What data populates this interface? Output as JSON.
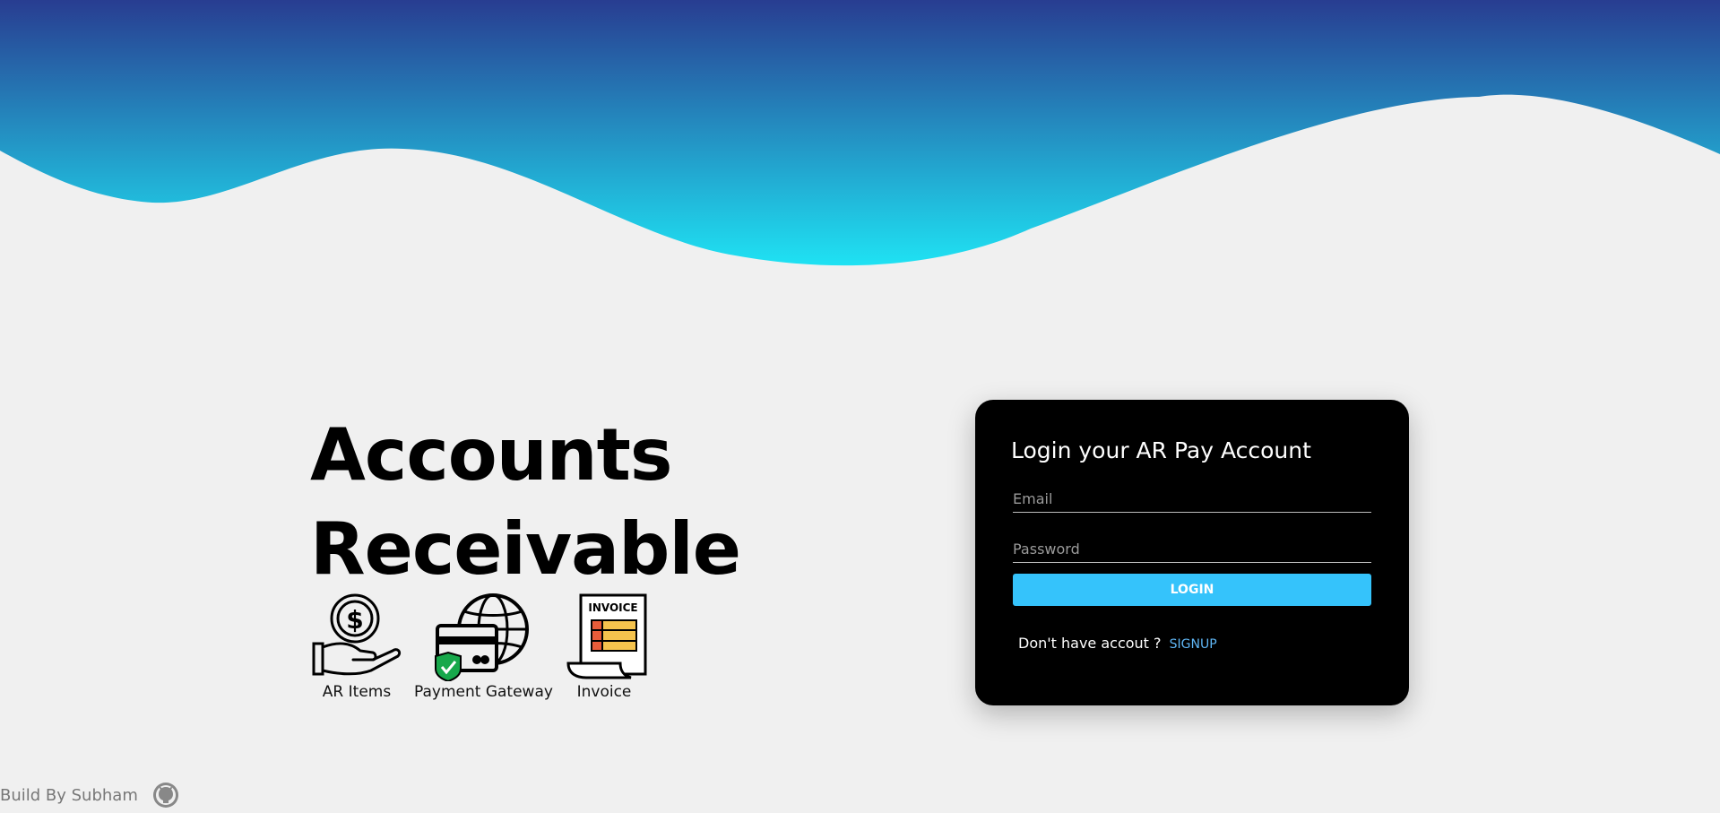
{
  "hero": {
    "title_line1": "Accounts",
    "title_line2": "Receivable"
  },
  "features": [
    {
      "label": "AR Items",
      "icon": "hand-coin-icon"
    },
    {
      "label": "Payment Gateway",
      "icon": "payment-gateway-icon"
    },
    {
      "label": "Invoice",
      "icon": "invoice-icon"
    }
  ],
  "invoice_icon_text": "INVOICE",
  "login_card": {
    "title": "Login your AR Pay Account",
    "email_placeholder": "Email",
    "password_placeholder": "Password",
    "login_button": "LOGIN",
    "signup_prompt": "Don't have accout ?",
    "signup_link": "SIGNUP"
  },
  "footer": {
    "text": "Build By Subham",
    "icon": "github-icon"
  },
  "colors": {
    "wave_top": "#283d91",
    "wave_bottom": "#1fe2f3",
    "background": "#f0f0f0",
    "card": "#000000",
    "button": "#35c3fb",
    "link": "#5fb6f5"
  }
}
